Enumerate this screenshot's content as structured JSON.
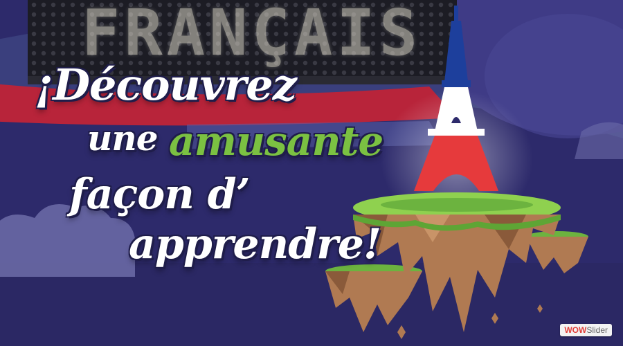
{
  "slide": {
    "board_text": "FRANÇAIS",
    "headline": {
      "line1": "¡Découvrez",
      "line2_a": "une",
      "line2_b": "amusante",
      "line3": "façon d’",
      "line4": "apprendre!"
    }
  },
  "badge": {
    "brand_part1": "WOW",
    "brand_part2": "Slider"
  },
  "colors": {
    "background": "#2d2a6b",
    "accent_green": "#7bc142",
    "flag_blue": "#1d3f9c",
    "flag_white": "#ffffff",
    "flag_red": "#e63a3c"
  },
  "icons": [
    "eiffel-tower-icon",
    "floating-island-icon",
    "cloud-icon"
  ]
}
